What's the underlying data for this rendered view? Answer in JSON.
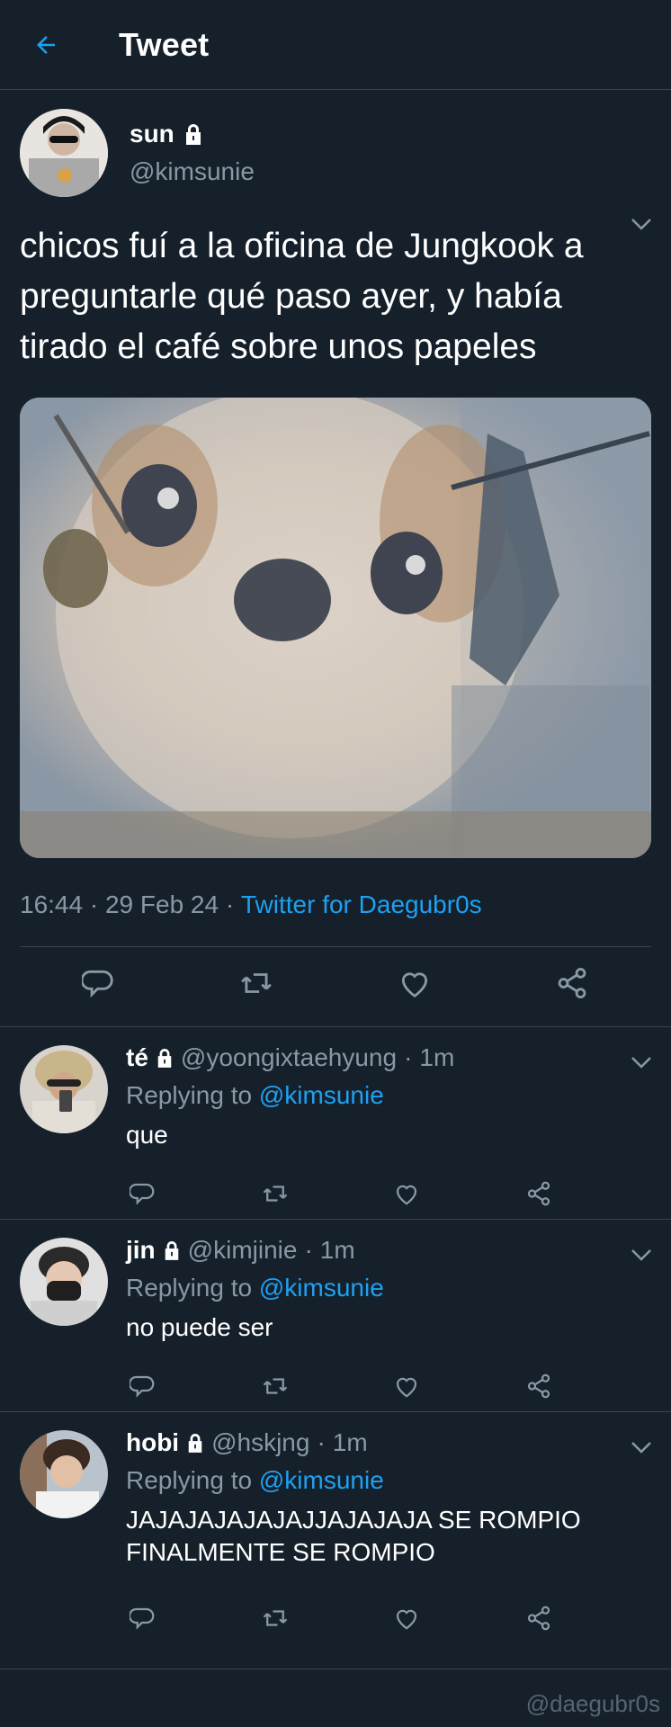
{
  "header": {
    "title": "Tweet"
  },
  "tweet": {
    "author": {
      "name": "sun",
      "handle": "@kimsunie"
    },
    "text": "chicos fuí a la oficina de Jungkook a preguntarle qué paso ayer, y había tirado el café sobre unos papeles",
    "time": "16:44",
    "date": "29 Feb 24",
    "source": "Twitter for Daegubr0s"
  },
  "replies": [
    {
      "name": "té",
      "handle": "@yoongixtaehyung",
      "time": "1m",
      "replying_label": "Replying to",
      "replying_to": "@kimsunie",
      "text": "que"
    },
    {
      "name": "jin",
      "handle": "@kimjinie",
      "time": "1m",
      "replying_label": "Replying to",
      "replying_to": "@kimsunie",
      "text": "no puede ser"
    },
    {
      "name": "hobi",
      "handle": "@hskjng",
      "time": "1m",
      "replying_label": "Replying to",
      "replying_to": "@kimsunie",
      "text": "JAJAJAJAJAJAJJAJAJAJA SE ROMPIO FINALMENTE SE ROMPIO"
    }
  ],
  "dot_separator": "·",
  "watermark": "@daegubr0s",
  "icons": {
    "back": "arrow-left-icon",
    "lock": "lock-icon",
    "chevron": "chevron-down-icon",
    "reply": "reply-icon",
    "retweet": "retweet-icon",
    "like": "heart-icon",
    "share": "share-icon"
  },
  "colors": {
    "background": "#15202b",
    "accent": "#1da1f2",
    "muted": "#8899a6",
    "divider": "#38444d"
  }
}
